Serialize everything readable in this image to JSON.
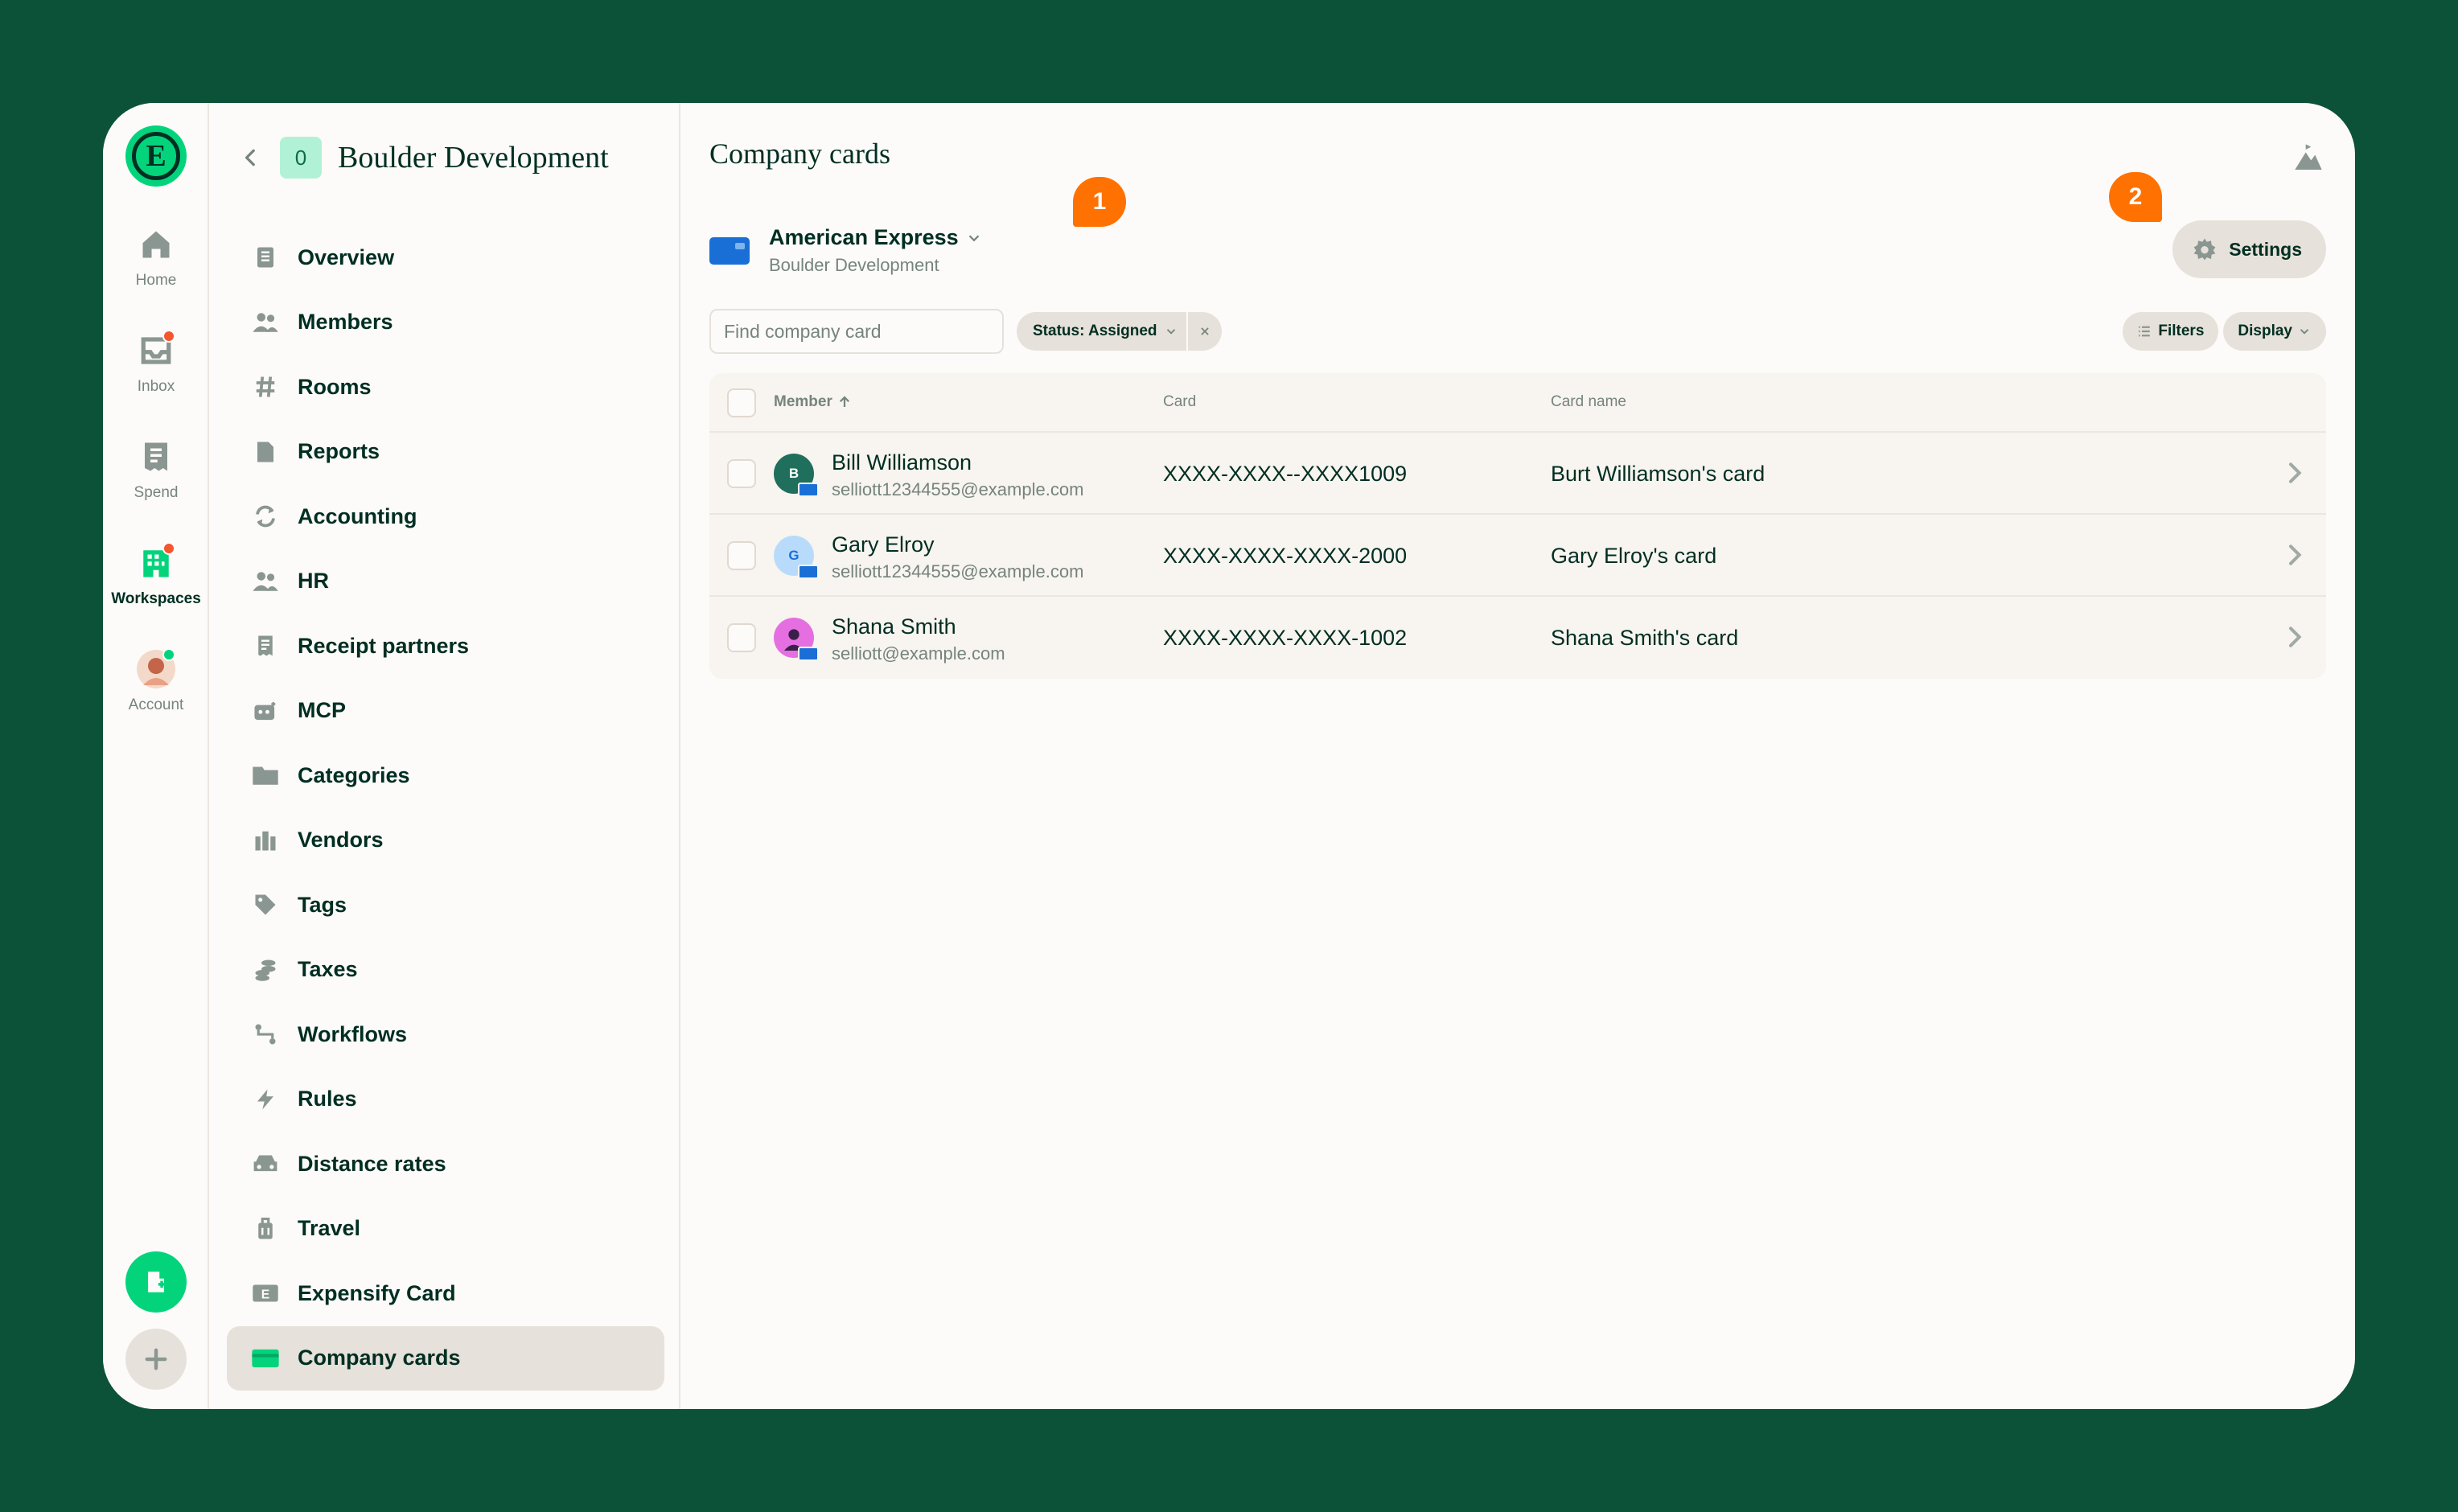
{
  "rail": {
    "logo": "E",
    "items": [
      {
        "label": "Home",
        "icon": "home-icon"
      },
      {
        "label": "Inbox",
        "icon": "inbox-icon"
      },
      {
        "label": "Spend",
        "icon": "receipt-icon"
      },
      {
        "label": "Workspaces",
        "icon": "building-icon"
      },
      {
        "label": "Account",
        "icon": "avatar"
      }
    ]
  },
  "sidebar": {
    "workspace_badge": "0",
    "workspace_name": "Boulder Development",
    "items": [
      {
        "label": "Overview",
        "icon": "document-icon"
      },
      {
        "label": "Members",
        "icon": "users-icon"
      },
      {
        "label": "Rooms",
        "icon": "hashtag-icon"
      },
      {
        "label": "Reports",
        "icon": "file-icon"
      },
      {
        "label": "Accounting",
        "icon": "sync-icon"
      },
      {
        "label": "HR",
        "icon": "users-icon"
      },
      {
        "label": "Receipt partners",
        "icon": "receipt-icon"
      },
      {
        "label": "MCP",
        "icon": "robot-icon"
      },
      {
        "label": "Categories",
        "icon": "folder-icon"
      },
      {
        "label": "Vendors",
        "icon": "building-icon"
      },
      {
        "label": "Tags",
        "icon": "tag-icon"
      },
      {
        "label": "Taxes",
        "icon": "coins-icon"
      },
      {
        "label": "Workflows",
        "icon": "workflow-icon"
      },
      {
        "label": "Rules",
        "icon": "lightning-icon"
      },
      {
        "label": "Distance rates",
        "icon": "car-icon"
      },
      {
        "label": "Travel",
        "icon": "suitcase-icon"
      },
      {
        "label": "Expensify Card",
        "icon": "expensify-card-icon"
      },
      {
        "label": "Company cards",
        "icon": "credit-card-icon",
        "active": true
      }
    ]
  },
  "main": {
    "title": "Company cards",
    "feed": {
      "name": "American Express",
      "workspace": "Boulder Development"
    },
    "annotations": [
      "1",
      "2"
    ],
    "settings_label": "Settings",
    "search_placeholder": "Find company card",
    "filter_chip": "Status: Assigned",
    "filters_label": "Filters",
    "display_label": "Display",
    "columns": {
      "member": "Member",
      "card": "Card",
      "card_name": "Card name"
    },
    "rows": [
      {
        "initial": "B",
        "avatar_color": "#1f6f5c",
        "name": "Bill Williamson",
        "email": "selliott12344555@example.com",
        "card": "XXXX-XXXX--XXXX1009",
        "card_name": "Burt Williamson's card"
      },
      {
        "initial": "G",
        "avatar_color": "#9cc8f5",
        "name": "Gary Elroy",
        "email": "selliott12344555@example.com",
        "card": "XXXX-XXXX-XXXX-2000",
        "card_name": "Gary Elroy's card"
      },
      {
        "initial": "",
        "avatar_color": "#e56fe0",
        "name": "Shana Smith",
        "email": "selliott@example.com",
        "card": "XXXX-XXXX-XXXX-1002",
        "card_name": "Shana Smith's card"
      }
    ]
  },
  "colors": {
    "background": "#0b5239",
    "accent_green": "#03d47c",
    "annotation_orange": "#ff7101",
    "card_blue": "#1a6fd6"
  }
}
